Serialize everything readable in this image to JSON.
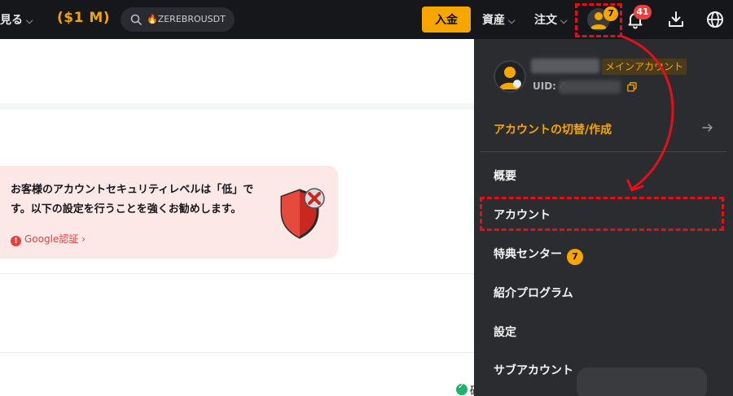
{
  "nav": {
    "more_label": "見る",
    "promo_label": "($1 M)",
    "search_text": "🔥ZEREBROUSDT",
    "deposit_label": "入金",
    "assets_label": "資産",
    "orders_label": "注文",
    "avatar_badge": "7",
    "notification_count": "41"
  },
  "main": {
    "alert_line1": "お客様のアカウントセキュリティレベルは「低」で",
    "alert_line2": "す。以下の設定を行うことを強くお勧めします。",
    "alert_link": "Google認証 ›",
    "status_char": "破"
  },
  "panel": {
    "main_account_badge": "メインアカウント",
    "uid_label": "UID: 4",
    "switch_label": "アカウントの切替/作成",
    "menu": [
      {
        "label": "概要"
      },
      {
        "label": "アカウント"
      },
      {
        "label": "特典センター",
        "badge": "7"
      },
      {
        "label": "紹介プログラム"
      },
      {
        "label": "設定"
      },
      {
        "label": "サブアカウント"
      }
    ]
  },
  "colors": {
    "accent": "#f7a600",
    "danger": "#e8413c",
    "annotation": "#e3101a",
    "navbar": "#16171b",
    "panel": "#2b2c30"
  }
}
